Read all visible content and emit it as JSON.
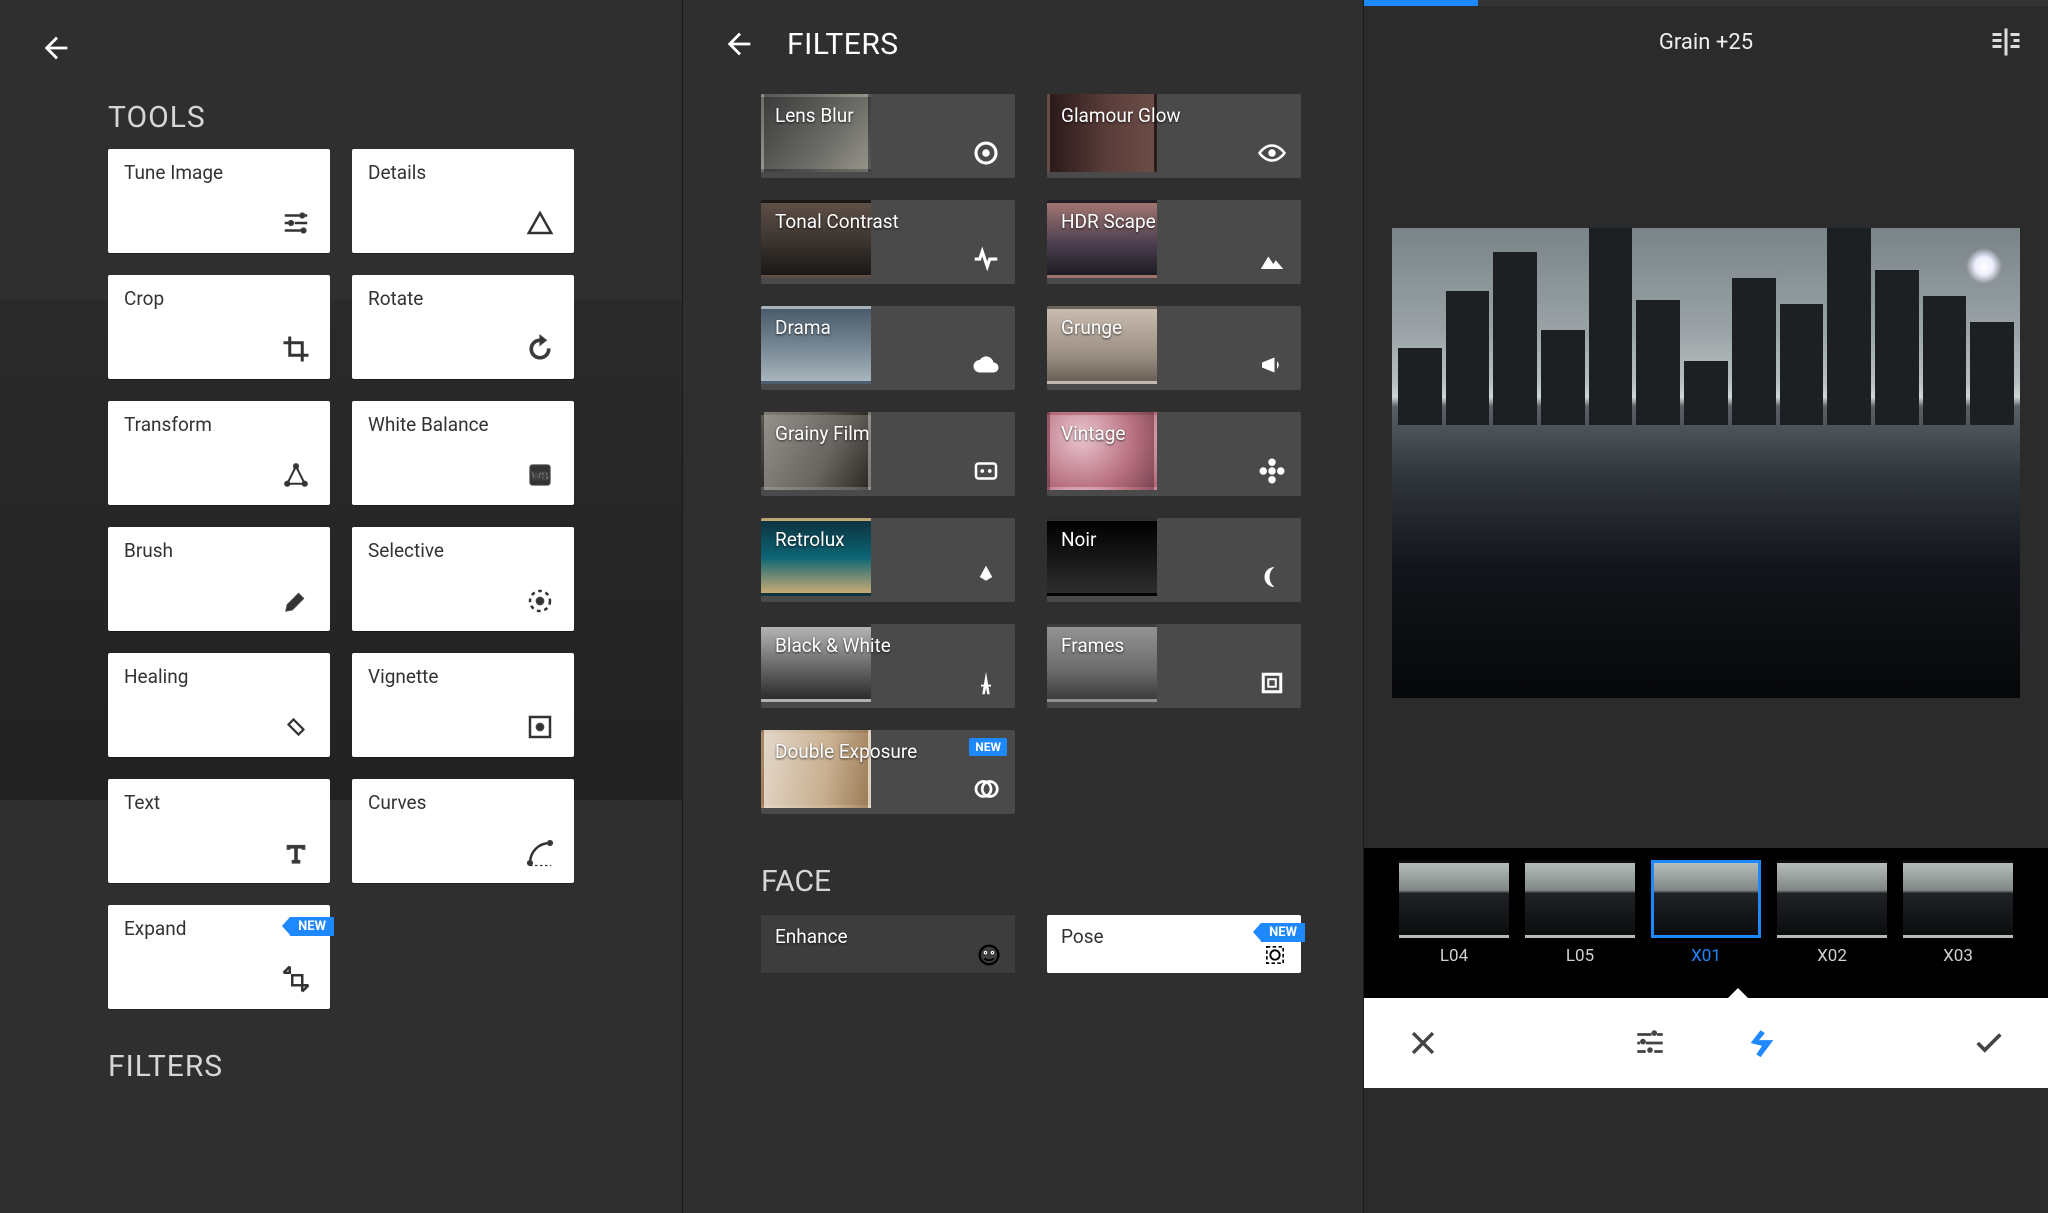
{
  "pane1": {
    "section_tools": "TOOLS",
    "section_filters": "FILTERS",
    "tools": [
      {
        "label": "Tune Image",
        "icon": "sliders"
      },
      {
        "label": "Details",
        "icon": "triangle"
      },
      {
        "label": "Crop",
        "icon": "crop"
      },
      {
        "label": "Rotate",
        "icon": "rotate"
      },
      {
        "label": "Transform",
        "icon": "transform"
      },
      {
        "label": "White Balance",
        "icon": "wb"
      },
      {
        "label": "Brush",
        "icon": "brush"
      },
      {
        "label": "Selective",
        "icon": "selective"
      },
      {
        "label": "Healing",
        "icon": "healing"
      },
      {
        "label": "Vignette",
        "icon": "vignette"
      },
      {
        "label": "Text",
        "icon": "text"
      },
      {
        "label": "Curves",
        "icon": "curves"
      },
      {
        "label": "Expand",
        "icon": "expand",
        "new": true
      }
    ],
    "new_badge": "NEW"
  },
  "pane2": {
    "title": "FILTERS",
    "filters": [
      {
        "label": "Lens Blur",
        "icon": "target",
        "bg": "th-lensblur"
      },
      {
        "label": "Glamour Glow",
        "icon": "eye",
        "bg": "th-glow"
      },
      {
        "label": "Tonal Contrast",
        "icon": "pulse",
        "bg": "th-tonal"
      },
      {
        "label": "HDR Scape",
        "icon": "mountains",
        "bg": "th-hdr"
      },
      {
        "label": "Drama",
        "icon": "cloud",
        "bg": "th-drama"
      },
      {
        "label": "Grunge",
        "icon": "megaphone",
        "bg": "th-grunge"
      },
      {
        "label": "Grainy Film",
        "icon": "film",
        "bg": "th-grainy"
      },
      {
        "label": "Vintage",
        "icon": "flower",
        "bg": "th-vintage"
      },
      {
        "label": "Retrolux",
        "icon": "kite",
        "bg": "th-retro"
      },
      {
        "label": "Noir",
        "icon": "moon",
        "bg": "th-noir"
      },
      {
        "label": "Black & White",
        "icon": "eiffel",
        "bg": "th-bw"
      },
      {
        "label": "Frames",
        "icon": "frame",
        "bg": "th-frames"
      },
      {
        "label": "Double Exposure",
        "icon": "double",
        "bg": "th-dbl",
        "new": true
      }
    ],
    "section_face": "FACE",
    "face": [
      {
        "label": "Enhance"
      },
      {
        "label": "Pose",
        "new": true
      }
    ],
    "new_badge": "NEW"
  },
  "pane3": {
    "header": "Grain +25",
    "presets": [
      {
        "label": "L04",
        "active": false
      },
      {
        "label": "L05",
        "active": false
      },
      {
        "label": "X01",
        "active": true
      },
      {
        "label": "X02",
        "active": false
      },
      {
        "label": "X03",
        "active": false
      }
    ]
  }
}
